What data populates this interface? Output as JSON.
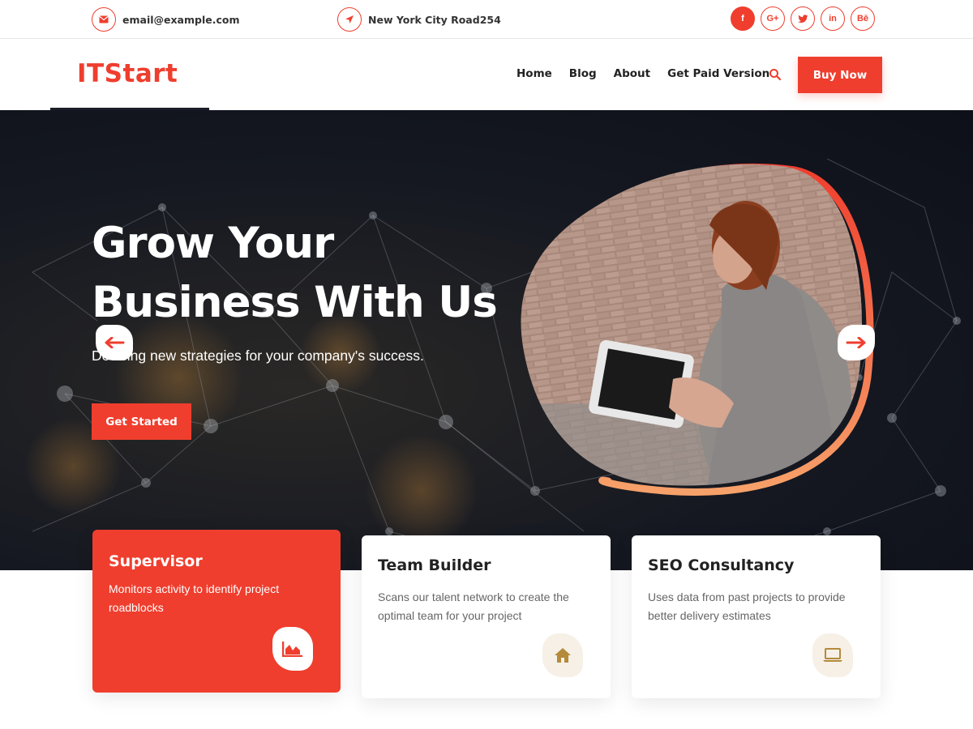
{
  "topbar": {
    "email": "email@example.com",
    "address": "New York City Road254",
    "social": [
      {
        "icon": "facebook-icon",
        "label": "f"
      },
      {
        "icon": "google-plus-icon",
        "label": "G+"
      },
      {
        "icon": "twitter-icon",
        "label": "t"
      },
      {
        "icon": "linkedin-icon",
        "label": "in"
      },
      {
        "icon": "behance-icon",
        "label": "Bē"
      }
    ]
  },
  "header": {
    "logo": "ITStart",
    "nav": [
      "Home",
      "Blog",
      "About",
      "Get Paid Version"
    ],
    "buy_label": "Buy Now"
  },
  "hero": {
    "title_line1": "Grow Your",
    "title_line2": "Business With Us",
    "subtitle": "Devising new strategies for your company's success.",
    "cta_label": "Get Started"
  },
  "cards": [
    {
      "title": "Supervisor",
      "text": "Monitors activity to identify project roadblocks",
      "icon": "chart-icon"
    },
    {
      "title": "Team Builder",
      "text": "Scans our talent network to create the optimal team for your project",
      "icon": "home-icon"
    },
    {
      "title": "SEO Consultancy",
      "text": "Uses data from past projects to provide better delivery estimates",
      "icon": "laptop-icon"
    }
  ],
  "colors": {
    "accent": "#ef3e2e",
    "hero_bg": "#151821",
    "icon_gold": "#b48a3c"
  }
}
